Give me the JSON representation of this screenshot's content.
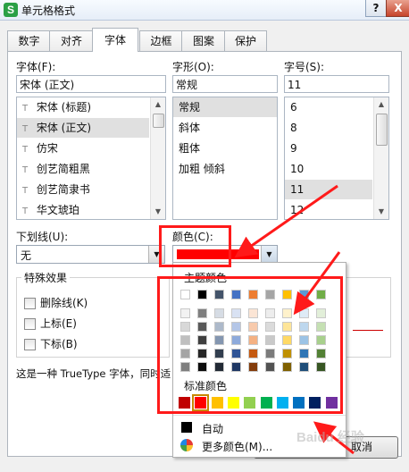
{
  "window": {
    "app_icon_letter": "S",
    "title": "单元格格式",
    "help_label": "?",
    "close_label": "X"
  },
  "tabs": [
    {
      "label": "数字"
    },
    {
      "label": "对齐"
    },
    {
      "label": "字体"
    },
    {
      "label": "边框"
    },
    {
      "label": "图案"
    },
    {
      "label": "保护"
    }
  ],
  "font": {
    "label": "字体(F):",
    "value": "宋体 (正文)",
    "items": [
      "宋体 (标题)",
      "宋体 (正文)",
      "仿宋",
      "创艺简粗黑",
      "创艺简隶书",
      "华文琥珀"
    ],
    "icon_text": "T"
  },
  "style": {
    "label": "字形(O):",
    "value": "常规",
    "items": [
      "常规",
      "斜体",
      "粗体",
      "加粗 倾斜"
    ]
  },
  "size": {
    "label": "字号(S):",
    "value": "11",
    "items": [
      "6",
      "8",
      "9",
      "10",
      "11",
      "12"
    ]
  },
  "underline": {
    "label": "下划线(U):",
    "value": "无"
  },
  "color": {
    "label": "颜色(C):",
    "selected_hex": "#ff0000"
  },
  "effects": {
    "title": "特殊效果",
    "strikethrough": "删除线(K)",
    "superscript": "上标(E)",
    "subscript": "下标(B)"
  },
  "description": "这是一种 TrueType 字体，同时适",
  "popup": {
    "theme_title": "主题颜色",
    "standard_title": "标准颜色",
    "auto_label": "自动",
    "more_label": "更多颜色(M)...",
    "theme_top": [
      "#ffffff",
      "#000000",
      "#44546a",
      "#4472c4",
      "#ed7d31",
      "#a5a5a5",
      "#ffc000",
      "#5b9bd5",
      "#70ad47"
    ],
    "theme_shades": [
      [
        "#f2f2f2",
        "#7f7f7f",
        "#d6dce4",
        "#d9e2f3",
        "#fbe5d5",
        "#ededed",
        "#fff2cc",
        "#deebf6",
        "#e2efd9"
      ],
      [
        "#d8d8d8",
        "#595959",
        "#adb9ca",
        "#b4c6e7",
        "#f7caac",
        "#dbdbdb",
        "#fee599",
        "#bdd7ee",
        "#c5e0b3"
      ],
      [
        "#bfbfbf",
        "#3f3f3f",
        "#8496b0",
        "#8eaadb",
        "#f4b183",
        "#c9c9c9",
        "#ffd965",
        "#9cc3e5",
        "#a8d08d"
      ],
      [
        "#a5a5a5",
        "#262626",
        "#323e4f",
        "#2f5496",
        "#c55a11",
        "#7b7b7b",
        "#bf9000",
        "#2e75b5",
        "#538135"
      ],
      [
        "#7f7f7f",
        "#0c0c0c",
        "#222a35",
        "#1f3864",
        "#833c0b",
        "#525252",
        "#7f6000",
        "#1e4e79",
        "#375623"
      ]
    ],
    "standard": [
      "#c00000",
      "#ff0000",
      "#ffc000",
      "#ffff00",
      "#92d050",
      "#00b050",
      "#00b0f0",
      "#0070c0",
      "#002060",
      "#7030a0"
    ]
  },
  "buttons": {
    "cancel": "取消"
  },
  "watermark": "Baidu 经验"
}
